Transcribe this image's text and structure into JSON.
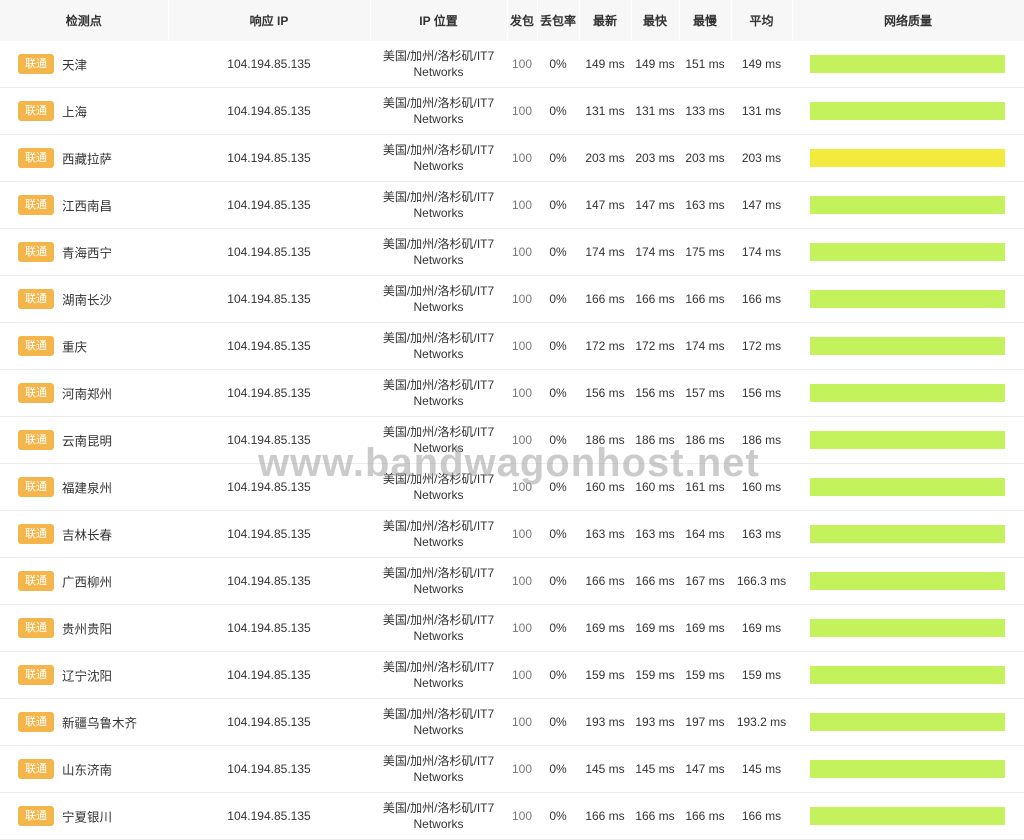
{
  "colors": {
    "badge": "#f4b64a",
    "bar_good": "#c4f25c",
    "bar_fair": "#f2ea3c"
  },
  "headers": {
    "node": "检测点",
    "ip": "响应 IP",
    "location": "IP 位置",
    "sent": "发包",
    "loss": "丢包率",
    "latest": "最新",
    "fastest": "最快",
    "slowest": "最慢",
    "average": "平均",
    "quality": "网络质量"
  },
  "rows": [
    {
      "isp": "联通",
      "city": "天津",
      "ip": "104.194.85.135",
      "loc1": "美国/加州/洛杉矶/IT7",
      "loc2": "Networks",
      "sent": "100",
      "loss": "0%",
      "latest": "149 ms",
      "fastest": "149 ms",
      "slowest": "151 ms",
      "average": "149 ms",
      "quality_color": "#c4f25c"
    },
    {
      "isp": "联通",
      "city": "上海",
      "ip": "104.194.85.135",
      "loc1": "美国/加州/洛杉矶/IT7",
      "loc2": "Networks",
      "sent": "100",
      "loss": "0%",
      "latest": "131 ms",
      "fastest": "131 ms",
      "slowest": "133 ms",
      "average": "131 ms",
      "quality_color": "#c4f25c"
    },
    {
      "isp": "联通",
      "city": "西藏拉萨",
      "ip": "104.194.85.135",
      "loc1": "美国/加州/洛杉矶/IT7",
      "loc2": "Networks",
      "sent": "100",
      "loss": "0%",
      "latest": "203 ms",
      "fastest": "203 ms",
      "slowest": "203 ms",
      "average": "203 ms",
      "quality_color": "#f2ea3c"
    },
    {
      "isp": "联通",
      "city": "江西南昌",
      "ip": "104.194.85.135",
      "loc1": "美国/加州/洛杉矶/IT7",
      "loc2": "Networks",
      "sent": "100",
      "loss": "0%",
      "latest": "147 ms",
      "fastest": "147 ms",
      "slowest": "163 ms",
      "average": "147 ms",
      "quality_color": "#c4f25c"
    },
    {
      "isp": "联通",
      "city": "青海西宁",
      "ip": "104.194.85.135",
      "loc1": "美国/加州/洛杉矶/IT7",
      "loc2": "Networks",
      "sent": "100",
      "loss": "0%",
      "latest": "174 ms",
      "fastest": "174 ms",
      "slowest": "175 ms",
      "average": "174 ms",
      "quality_color": "#c4f25c"
    },
    {
      "isp": "联通",
      "city": "湖南长沙",
      "ip": "104.194.85.135",
      "loc1": "美国/加州/洛杉矶/IT7",
      "loc2": "Networks",
      "sent": "100",
      "loss": "0%",
      "latest": "166 ms",
      "fastest": "166 ms",
      "slowest": "166 ms",
      "average": "166 ms",
      "quality_color": "#c4f25c"
    },
    {
      "isp": "联通",
      "city": "重庆",
      "ip": "104.194.85.135",
      "loc1": "美国/加州/洛杉矶/IT7",
      "loc2": "Networks",
      "sent": "100",
      "loss": "0%",
      "latest": "172 ms",
      "fastest": "172 ms",
      "slowest": "174 ms",
      "average": "172 ms",
      "quality_color": "#c4f25c"
    },
    {
      "isp": "联通",
      "city": "河南郑州",
      "ip": "104.194.85.135",
      "loc1": "美国/加州/洛杉矶/IT7",
      "loc2": "Networks",
      "sent": "100",
      "loss": "0%",
      "latest": "156 ms",
      "fastest": "156 ms",
      "slowest": "157 ms",
      "average": "156 ms",
      "quality_color": "#c4f25c"
    },
    {
      "isp": "联通",
      "city": "云南昆明",
      "ip": "104.194.85.135",
      "loc1": "美国/加州/洛杉矶/IT7",
      "loc2": "Networks",
      "sent": "100",
      "loss": "0%",
      "latest": "186 ms",
      "fastest": "186 ms",
      "slowest": "186 ms",
      "average": "186 ms",
      "quality_color": "#c4f25c"
    },
    {
      "isp": "联通",
      "city": "福建泉州",
      "ip": "104.194.85.135",
      "loc1": "美国/加州/洛杉矶/IT7",
      "loc2": "Networks",
      "sent": "100",
      "loss": "0%",
      "latest": "160 ms",
      "fastest": "160 ms",
      "slowest": "161 ms",
      "average": "160 ms",
      "quality_color": "#c4f25c"
    },
    {
      "isp": "联通",
      "city": "吉林长春",
      "ip": "104.194.85.135",
      "loc1": "美国/加州/洛杉矶/IT7",
      "loc2": "Networks",
      "sent": "100",
      "loss": "0%",
      "latest": "163 ms",
      "fastest": "163 ms",
      "slowest": "164 ms",
      "average": "163 ms",
      "quality_color": "#c4f25c"
    },
    {
      "isp": "联通",
      "city": "广西柳州",
      "ip": "104.194.85.135",
      "loc1": "美国/加州/洛杉矶/IT7",
      "loc2": "Networks",
      "sent": "100",
      "loss": "0%",
      "latest": "166 ms",
      "fastest": "166 ms",
      "slowest": "167 ms",
      "average": "166.3 ms",
      "quality_color": "#c4f25c"
    },
    {
      "isp": "联通",
      "city": "贵州贵阳",
      "ip": "104.194.85.135",
      "loc1": "美国/加州/洛杉矶/IT7",
      "loc2": "Networks",
      "sent": "100",
      "loss": "0%",
      "latest": "169 ms",
      "fastest": "169 ms",
      "slowest": "169 ms",
      "average": "169 ms",
      "quality_color": "#c4f25c"
    },
    {
      "isp": "联通",
      "city": "辽宁沈阳",
      "ip": "104.194.85.135",
      "loc1": "美国/加州/洛杉矶/IT7",
      "loc2": "Networks",
      "sent": "100",
      "loss": "0%",
      "latest": "159 ms",
      "fastest": "159 ms",
      "slowest": "159 ms",
      "average": "159 ms",
      "quality_color": "#c4f25c"
    },
    {
      "isp": "联通",
      "city": "新疆乌鲁木齐",
      "ip": "104.194.85.135",
      "loc1": "美国/加州/洛杉矶/IT7",
      "loc2": "Networks",
      "sent": "100",
      "loss": "0%",
      "latest": "193 ms",
      "fastest": "193 ms",
      "slowest": "197 ms",
      "average": "193.2 ms",
      "quality_color": "#c4f25c"
    },
    {
      "isp": "联通",
      "city": "山东济南",
      "ip": "104.194.85.135",
      "loc1": "美国/加州/洛杉矶/IT7",
      "loc2": "Networks",
      "sent": "100",
      "loss": "0%",
      "latest": "145 ms",
      "fastest": "145 ms",
      "slowest": "147 ms",
      "average": "145 ms",
      "quality_color": "#c4f25c"
    },
    {
      "isp": "联通",
      "city": "宁夏银川",
      "ip": "104.194.85.135",
      "loc1": "美国/加州/洛杉矶/IT7",
      "loc2": "Networks",
      "sent": "100",
      "loss": "0%",
      "latest": "166 ms",
      "fastest": "166 ms",
      "slowest": "166 ms",
      "average": "166 ms",
      "quality_color": "#c4f25c"
    }
  ],
  "watermark": "www.bandwagonhost.net"
}
